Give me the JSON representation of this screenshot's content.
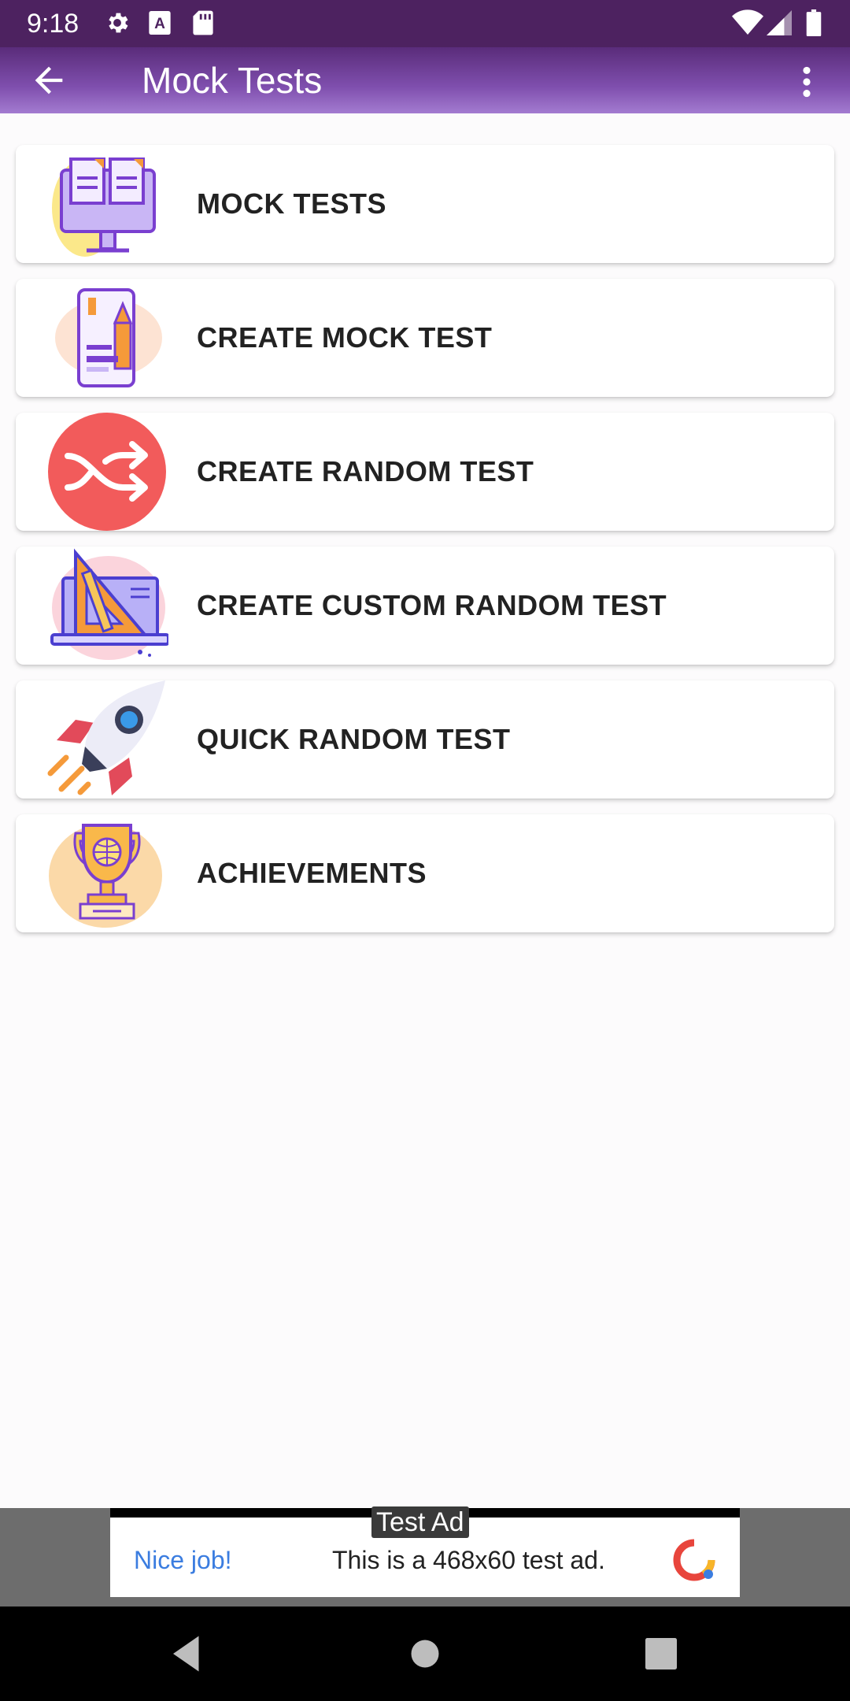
{
  "status_bar": {
    "time": "9:18",
    "icons": [
      "gear-icon",
      "a-icon",
      "sd-card-icon",
      "wifi-icon",
      "signal-icon",
      "battery-icon"
    ]
  },
  "app_bar": {
    "title": "Mock Tests",
    "back_icon": "arrow-back-icon",
    "overflow_icon": "more-vert-icon"
  },
  "menu": {
    "items": [
      {
        "label": "MOCK TESTS",
        "icon": "computer-documents-icon"
      },
      {
        "label": "CREATE MOCK TEST",
        "icon": "tablet-pencil-icon"
      },
      {
        "label": "CREATE RANDOM TEST",
        "icon": "shuffle-icon"
      },
      {
        "label": "CREATE CUSTOM RANDOM TEST",
        "icon": "laptop-ruler-icon"
      },
      {
        "label": "QUICK RANDOM TEST",
        "icon": "rocket-icon"
      },
      {
        "label": "ACHIEVEMENTS",
        "icon": "trophy-icon"
      }
    ]
  },
  "ad": {
    "tag": "Test Ad",
    "cta": "Nice job!",
    "text": "This is a 468x60 test ad."
  },
  "nav_bar": {
    "buttons": [
      "back-triangle-icon",
      "home-circle-icon",
      "recents-square-icon"
    ]
  },
  "colors": {
    "status_bar": "#4d2260",
    "app_bar_top": "#5a2c7a",
    "app_bar_bottom": "#a37bd0",
    "shuffle_red": "#f25b5b",
    "ad_cta": "#3b7de0"
  }
}
